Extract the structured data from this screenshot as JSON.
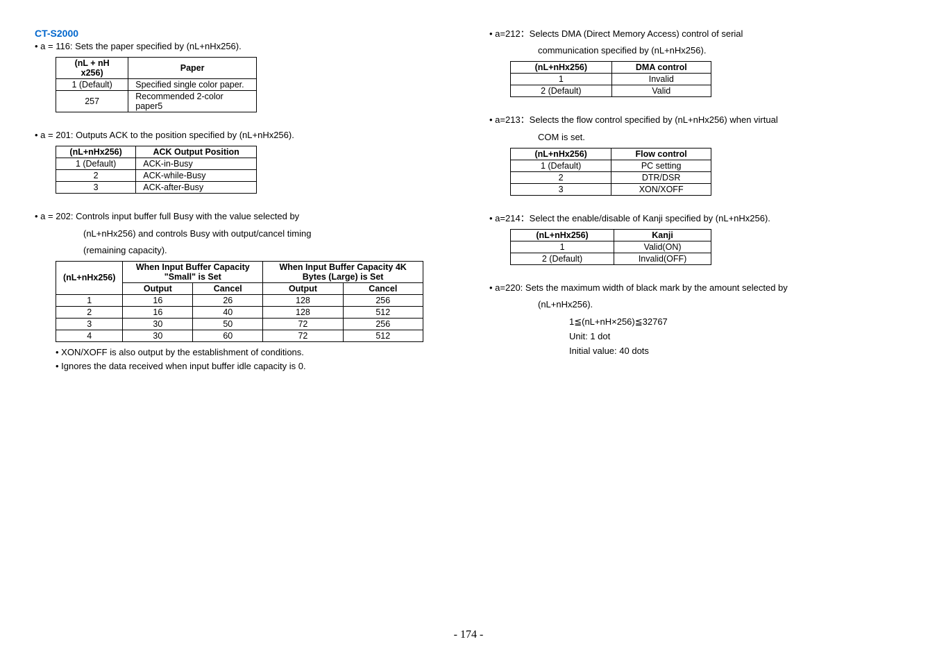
{
  "model": "CT-S2000",
  "left": {
    "a116": {
      "bullet": "• a = 116: Sets the paper specified by (nL+nHx256).",
      "table": {
        "headers": [
          "(nL + nH x256)",
          "Paper"
        ],
        "rows": [
          [
            "1 (Default)",
            "Specified single color paper."
          ],
          [
            "257",
            "Recommended 2-color paper5"
          ]
        ]
      }
    },
    "a201": {
      "bullet": "• a = 201: Outputs ACK to the position specified by (nL+nHx256).",
      "table": {
        "headers": [
          "(nL+nHx256)",
          "ACK Output Position"
        ],
        "rows": [
          [
            "1 (Default)",
            "ACK-in-Busy"
          ],
          [
            "2",
            "ACK-while-Busy"
          ],
          [
            "3",
            "ACK-after-Busy"
          ]
        ]
      }
    },
    "a202": {
      "bullet": "• a = 202: Controls input buffer full Busy with the value selected by",
      "cont1": "(nL+nHx256) and controls Busy with output/cancel timing",
      "cont2": "(remaining capacity).",
      "table": {
        "header_main": "(nL+nHx256)",
        "header_small": "When Input Buffer Capacity \"Small\" is Set",
        "header_large": "When Input Buffer Capacity 4K Bytes (Large) is Set",
        "sub_output": "Output",
        "sub_cancel": "Cancel",
        "rows": [
          [
            "1",
            "16",
            "26",
            "128",
            "256"
          ],
          [
            "2",
            "16",
            "40",
            "128",
            "512"
          ],
          [
            "3",
            "30",
            "50",
            "72",
            "256"
          ],
          [
            "4",
            "30",
            "60",
            "72",
            "512"
          ]
        ]
      },
      "note1": "• XON/XOFF is also output by the establishment of conditions.",
      "note2": "• Ignores the data received when input buffer idle capacity is 0."
    }
  },
  "right": {
    "a212": {
      "bullet": "• a=212：Selects DMA (Direct Memory Access) control of serial",
      "cont": "communication specified by (nL+nHx256).",
      "table": {
        "headers": [
          "(nL+nHx256)",
          "DMA control"
        ],
        "rows": [
          [
            "1",
            "Invalid"
          ],
          [
            "2 (Default)",
            "Valid"
          ]
        ]
      }
    },
    "a213": {
      "bullet": "• a=213：Selects the flow control specified by (nL+nHx256) when virtual",
      "cont": "COM is set.",
      "table": {
        "headers": [
          "(nL+nHx256)",
          "Flow control"
        ],
        "rows": [
          [
            "1 (Default)",
            "PC setting"
          ],
          [
            "2",
            "DTR/DSR"
          ],
          [
            "3",
            "XON/XOFF"
          ]
        ]
      }
    },
    "a214": {
      "bullet": "• a=214：Select the enable/disable of Kanji specified by (nL+nHx256).",
      "table": {
        "headers": [
          "(nL+nHx256)",
          "Kanji"
        ],
        "rows": [
          [
            "1",
            "Valid(ON)"
          ],
          [
            "2 (Default)",
            "Invalid(OFF)"
          ]
        ]
      }
    },
    "a220": {
      "bullet": "• a=220: Sets the maximum width of black mark by the amount selected by",
      "cont": "(nL+nHx256).",
      "formula1": "1≦(nL+nH×256)≦32767",
      "formula2": "Unit: 1 dot",
      "formula3": "Initial value: 40 dots"
    }
  },
  "page": "- 174 -"
}
